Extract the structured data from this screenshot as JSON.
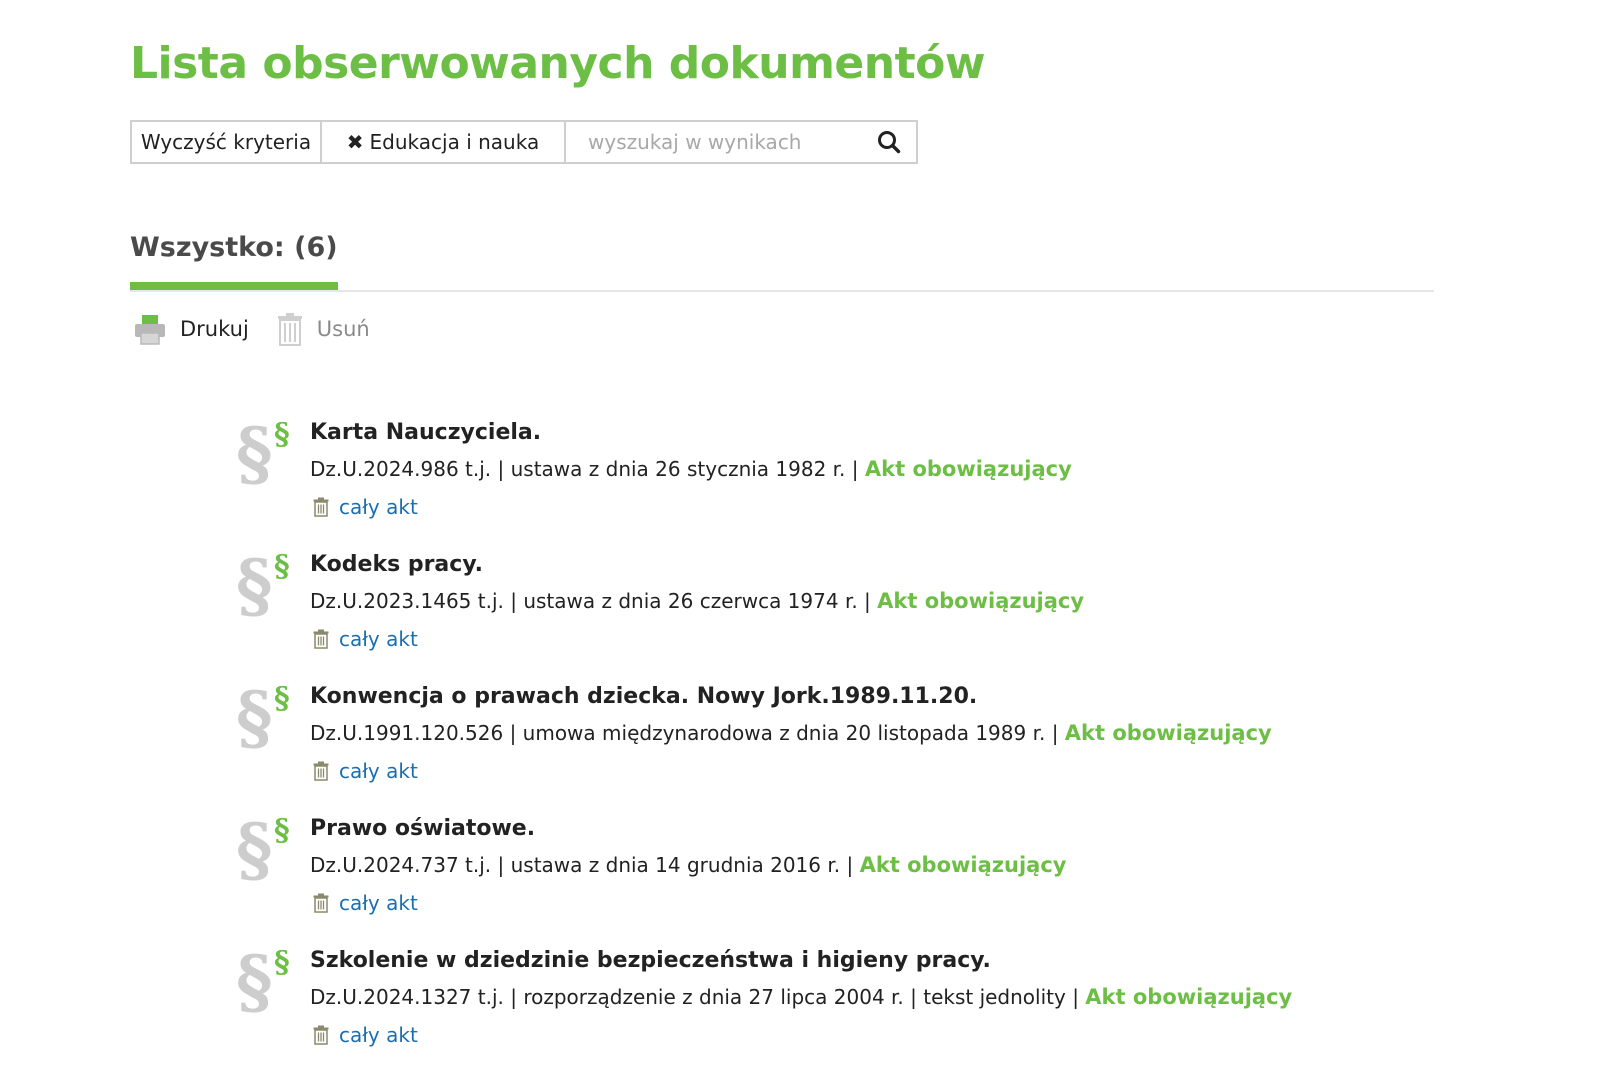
{
  "page": {
    "title": "Lista obserwowanych dokumentów"
  },
  "filters": {
    "clear_label": "Wyczyść kryteria",
    "tag_label": "Edukacja i nauka",
    "search_placeholder": "wyszukaj w wynikach",
    "search_value": ""
  },
  "tabs": {
    "active_label": "Wszystko: (6)"
  },
  "actions": {
    "print_label": "Drukuj",
    "delete_label": "Usuń"
  },
  "colors": {
    "accent": "#6cbe45",
    "link": "#1a6fb0"
  },
  "documents": [
    {
      "title": "Karta Nauczyciela.",
      "meta": "Dz.U.2024.986 t.j. | ustawa z dnia 26 stycznia 1982 r. | ",
      "status": "Akt obowiązujący",
      "link": "cały akt"
    },
    {
      "title": "Kodeks pracy.",
      "meta": "Dz.U.2023.1465 t.j. | ustawa z dnia 26 czerwca 1974 r. | ",
      "status": "Akt obowiązujący",
      "link": "cały akt"
    },
    {
      "title": "Konwencja o prawach dziecka. Nowy Jork.1989.11.20.",
      "meta": "Dz.U.1991.120.526 | umowa międzynarodowa z dnia 20 listopada 1989 r. | ",
      "status": "Akt obowiązujący",
      "link": "cały akt"
    },
    {
      "title": "Prawo oświatowe.",
      "meta": "Dz.U.2024.737 t.j. | ustawa z dnia 14 grudnia 2016 r. | ",
      "status": "Akt obowiązujący",
      "link": "cały akt"
    },
    {
      "title": "Szkolenie w dziedzinie bezpieczeństwa i higieny pracy.",
      "meta": "Dz.U.2024.1327 t.j. | rozporządzenie z dnia 27 lipca 2004 r. | tekst jednolity | ",
      "status": "Akt obowiązujący",
      "link": "cały akt"
    }
  ]
}
